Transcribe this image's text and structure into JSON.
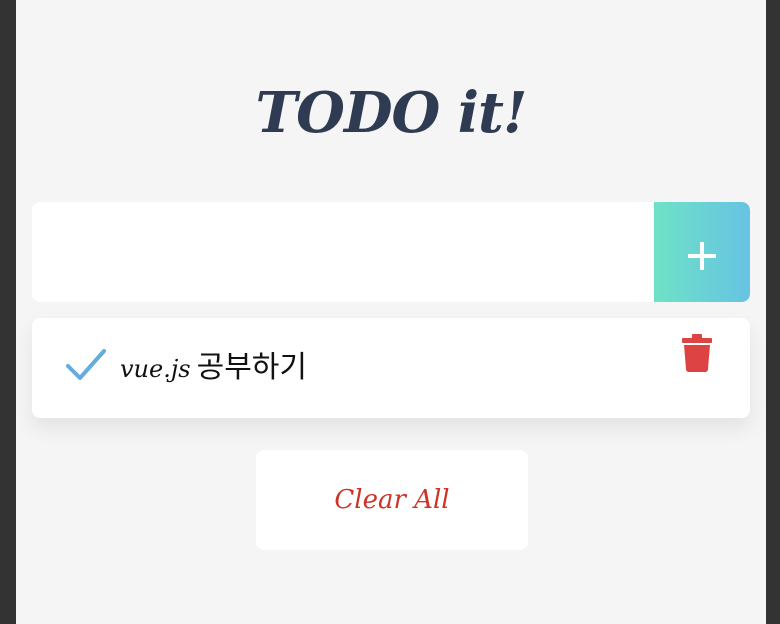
{
  "app": {
    "title": "TODO it!"
  },
  "input": {
    "value": "",
    "placeholder": "",
    "add_icon": "plus-icon"
  },
  "todos": [
    {
      "text_latin": "vue.js",
      "text_korean": "공부하기",
      "completed": false,
      "check_icon": "check-icon",
      "delete_icon": "trash-icon"
    }
  ],
  "footer": {
    "clear_label": "Clear All"
  },
  "colors": {
    "title": "#2f3b52",
    "add_gradient_start": "#6ee2c6",
    "add_gradient_end": "#67c3e3",
    "check": "#62acde",
    "trash": "#de4343",
    "clear_text": "#cf3328",
    "background": "#f5f5f5"
  }
}
